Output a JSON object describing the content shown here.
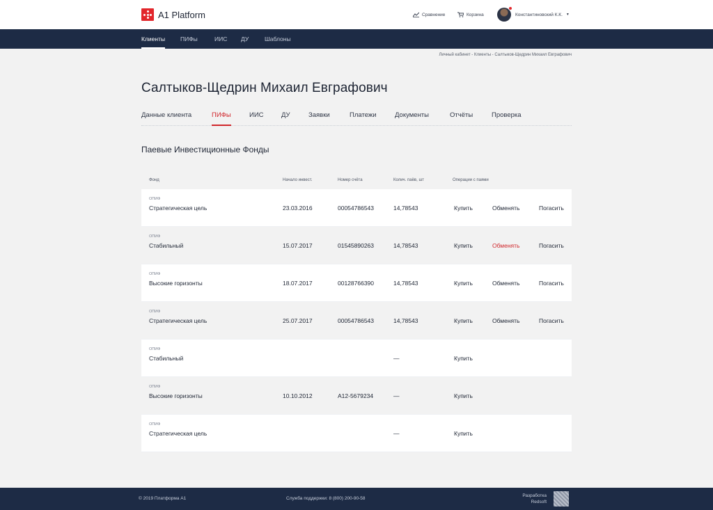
{
  "app": {
    "logo_text": "A1 Platform",
    "compare_label": "Сравнение",
    "cart_label": "Корзина",
    "user_name": "Константиновский К.К."
  },
  "nav": {
    "items": [
      "Клиенты",
      "ПИФы",
      "ИИС",
      "ДУ",
      "Шаблоны"
    ],
    "active": "Клиенты"
  },
  "breadcrumb": "Личный кабинет - Клиенты - Салтыков-Щедрин Михаил Евграфович",
  "page_title": "Салтыков-Щедрин Михаил Евграфович",
  "tabs": {
    "items": [
      "Данные клиента",
      "ПИФы",
      "ИИС",
      "ДУ",
      "Заявки",
      "Платежи",
      "Документы",
      "Отчёты",
      "Проверка"
    ],
    "active": "ПИФы"
  },
  "section_title": "Паевые Инвестиционные Фонды",
  "table": {
    "headers": {
      "fund": "Фонд",
      "start": "Начало инвест.",
      "account": "Номер счёта",
      "qty": "Колич. паёв, шт",
      "ops": "Операции с паями"
    },
    "op_labels": {
      "buy": "Купить",
      "exchange": "Обменять",
      "redeem": "Погасить"
    },
    "rows": [
      {
        "type": "ОПИФ",
        "name": "Стратегическая цель",
        "start": "23.03.2016",
        "account": "00054786543",
        "qty": "14,78543",
        "exchange": true,
        "redeem": true
      },
      {
        "type": "ОПИФ",
        "name": "Стабильный",
        "start": "15.07.2017",
        "account": "01545890263",
        "qty": "14,78543",
        "exchange": true,
        "redeem": true,
        "exchange_highlight": true
      },
      {
        "type": "ОПИФ",
        "name": "Высокие горизонты",
        "start": "18.07.2017",
        "account": "00128766390",
        "qty": "14,78543",
        "exchange": true,
        "redeem": true
      },
      {
        "type": "ОПИФ",
        "name": "Стратегическая цель",
        "start": "25.07.2017",
        "account": "00054786543",
        "qty": "14,78543",
        "exchange": true,
        "redeem": true
      },
      {
        "type": "ОПИФ",
        "name": "Стабильный",
        "start": "",
        "account": "",
        "qty": "—",
        "exchange": false,
        "redeem": false
      },
      {
        "type": "ОПИФ",
        "name": "Высокие горизонты",
        "start": "10.10.2012",
        "account": "А12-5679234",
        "qty": "—",
        "exchange": false,
        "redeem": false
      },
      {
        "type": "ОПИФ",
        "name": "Стратегическая цель",
        "start": "",
        "account": "",
        "qty": "—",
        "exchange": false,
        "redeem": false
      }
    ]
  },
  "footer": {
    "copyright": "© 2019 Платформа А1",
    "support": "Служба поддержки:  8 (800) 200-90-58",
    "dev_line1": "Разработка",
    "dev_line2": "Redsoft"
  },
  "colors": {
    "accent": "#d0262b",
    "navy": "#1d2b45",
    "background": "#f2f2f2"
  }
}
